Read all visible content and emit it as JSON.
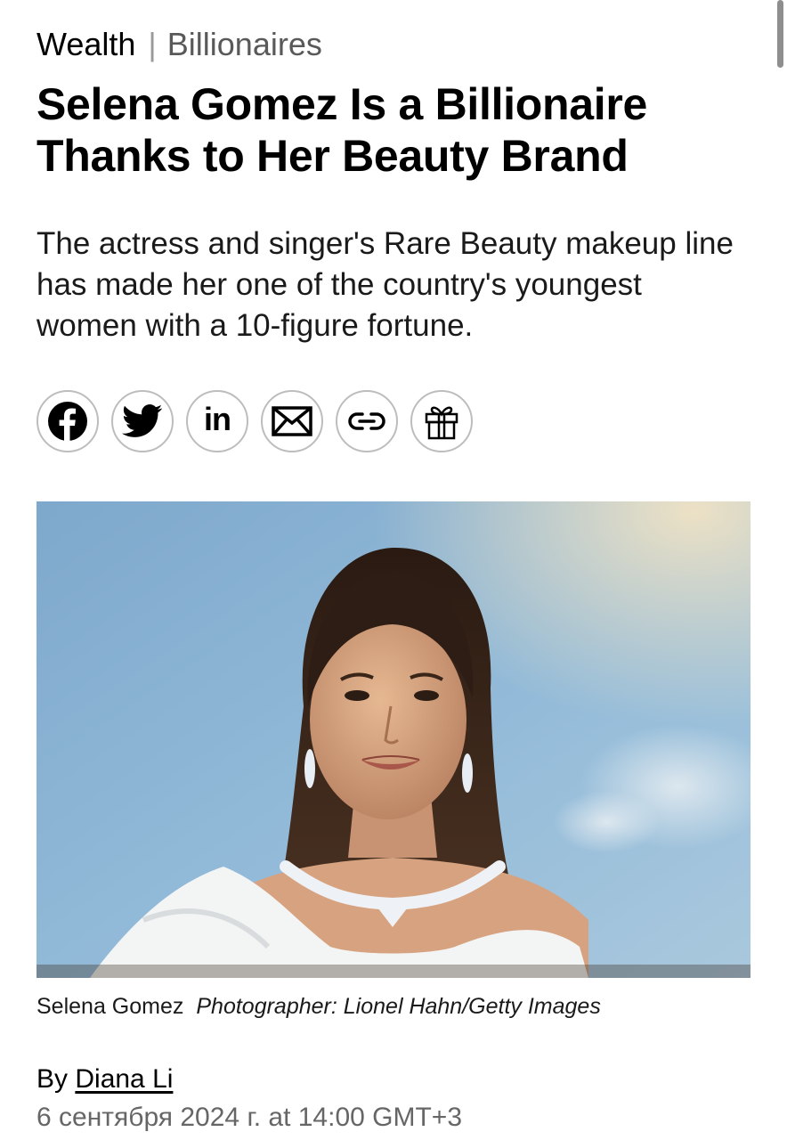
{
  "breadcrumb": {
    "section": "Wealth",
    "separator": "|",
    "subsection": "Billionaires"
  },
  "article": {
    "headline": "Selena Gomez Is a Billionaire Thanks to Her Beauty Brand",
    "dek": "The actress and singer's Rare Beauty makeup line has made her one of the country's youngest women with a 10-figure fortune."
  },
  "share": {
    "icons": [
      "facebook-icon",
      "twitter-icon",
      "linkedin-icon",
      "email-icon",
      "link-icon",
      "gift-icon"
    ],
    "linkedin_text": "in"
  },
  "photo": {
    "caption_subject": "Selena Gomez",
    "caption_credit": "Photographer: Lionel Hahn/Getty Images"
  },
  "byline": {
    "prefix": "By",
    "author": "Diana Li",
    "dateline": "6 сентября 2024 г. at 14:00 GMT+3"
  },
  "colors": {
    "text": "#000000",
    "muted": "#666666",
    "icon_border": "#bdbdbd",
    "scrollbar": "#8e8e8e"
  }
}
